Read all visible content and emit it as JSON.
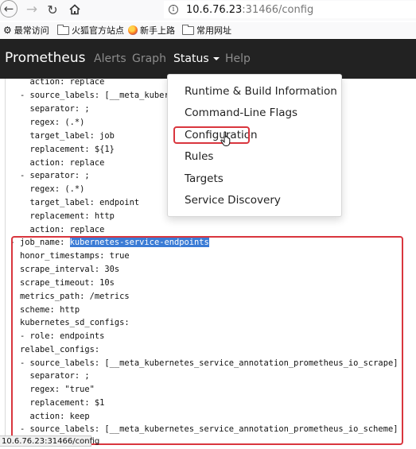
{
  "browser": {
    "url_host": "10.6.76.23",
    "url_rest": ":31466/config",
    "bookmarks": [
      {
        "label": "最常访问",
        "icon": "gear-icon"
      },
      {
        "label": "火狐官方站点",
        "icon": "folder-icon"
      },
      {
        "label": "新手上路",
        "icon": "firefox-icon"
      },
      {
        "label": "常用网址",
        "icon": "folder-icon"
      }
    ],
    "status_url": "10.6.76.23:31466/config"
  },
  "navbar": {
    "brand": "Prometheus",
    "links": [
      "Alerts",
      "Graph",
      "Status",
      "Help"
    ]
  },
  "dropdown": {
    "items": [
      "Runtime & Build Information",
      "Command-Line Flags",
      "Configuration",
      "Rules",
      "Targets",
      "Service Discovery"
    ]
  },
  "config": {
    "lines": [
      "      action: replace",
      "    - source_labels: [__meta_kubernetes_",
      "      separator: ;",
      "      regex: (.*)",
      "      target_label: job",
      "      replacement: ${1}",
      "      action: replace",
      "    - separator: ;",
      "      regex: (.*)",
      "      target_label: endpoint",
      "      replacement: http",
      "      action: replace",
      "  - job_name: ",
      "    honor_timestamps: true",
      "    scrape_interval: 30s",
      "    scrape_timeout: 10s",
      "    metrics_path: /metrics",
      "    scheme: http",
      "    kubernetes_sd_configs:",
      "    - role: endpoints",
      "    relabel_configs:",
      "    - source_labels: [__meta_kubernetes_service_annotation_prometheus_io_scrape]",
      "      separator: ;",
      "      regex: \"true\"",
      "      replacement: $1",
      "      action: keep",
      "    - source_labels: [__meta_kubernetes_service_annotation_prometheus_io_scheme]"
    ],
    "highlight": "kubernetes-service-endpoints"
  }
}
